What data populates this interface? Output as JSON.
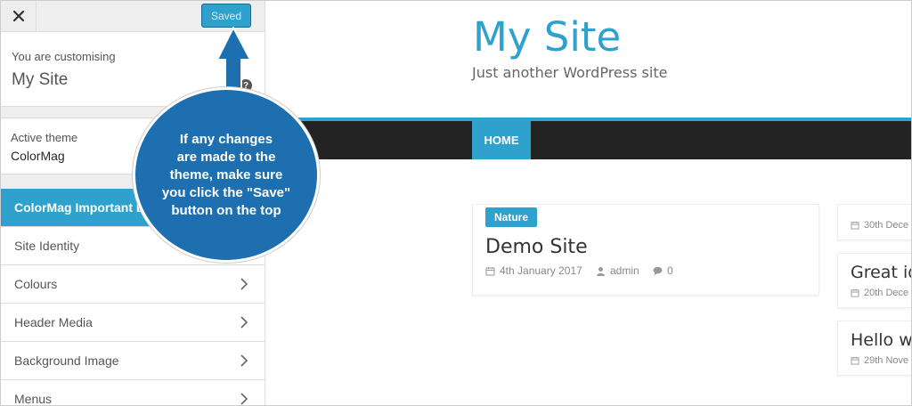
{
  "customizer": {
    "close_label": "×",
    "saved_label": "Saved",
    "customizing_label": "You are customising",
    "site_name": "My Site",
    "help_label": "?",
    "active_theme_label": "Active theme",
    "active_theme_name": "ColorMag",
    "menu_items": [
      {
        "label": "ColorMag Important Li"
      },
      {
        "label": "Site Identity"
      },
      {
        "label": "Colours"
      },
      {
        "label": "Header Media"
      },
      {
        "label": "Background Image"
      },
      {
        "label": "Menus"
      }
    ]
  },
  "preview": {
    "site_title": "My Site",
    "tagline": "Just another WordPress site",
    "nav_home": "HOME",
    "post": {
      "category": "Nature",
      "title": "Demo Site",
      "date": "4th January 2017",
      "author": "admin",
      "comments": "0"
    },
    "side_posts": [
      {
        "title": "",
        "date": "30th Dece"
      },
      {
        "title": "Great ide",
        "date": "20th Dece"
      },
      {
        "title": "Hello wo",
        "date": "29th Nove"
      }
    ]
  },
  "callout": {
    "text": "If any changes\nare made to the\ntheme, make sure\nyou click the \"Save\"\nbutton on the top"
  },
  "colors": {
    "accent": "#2ea2cc",
    "callout_blue": "#1e6fb0",
    "nav_dark": "#232323"
  }
}
